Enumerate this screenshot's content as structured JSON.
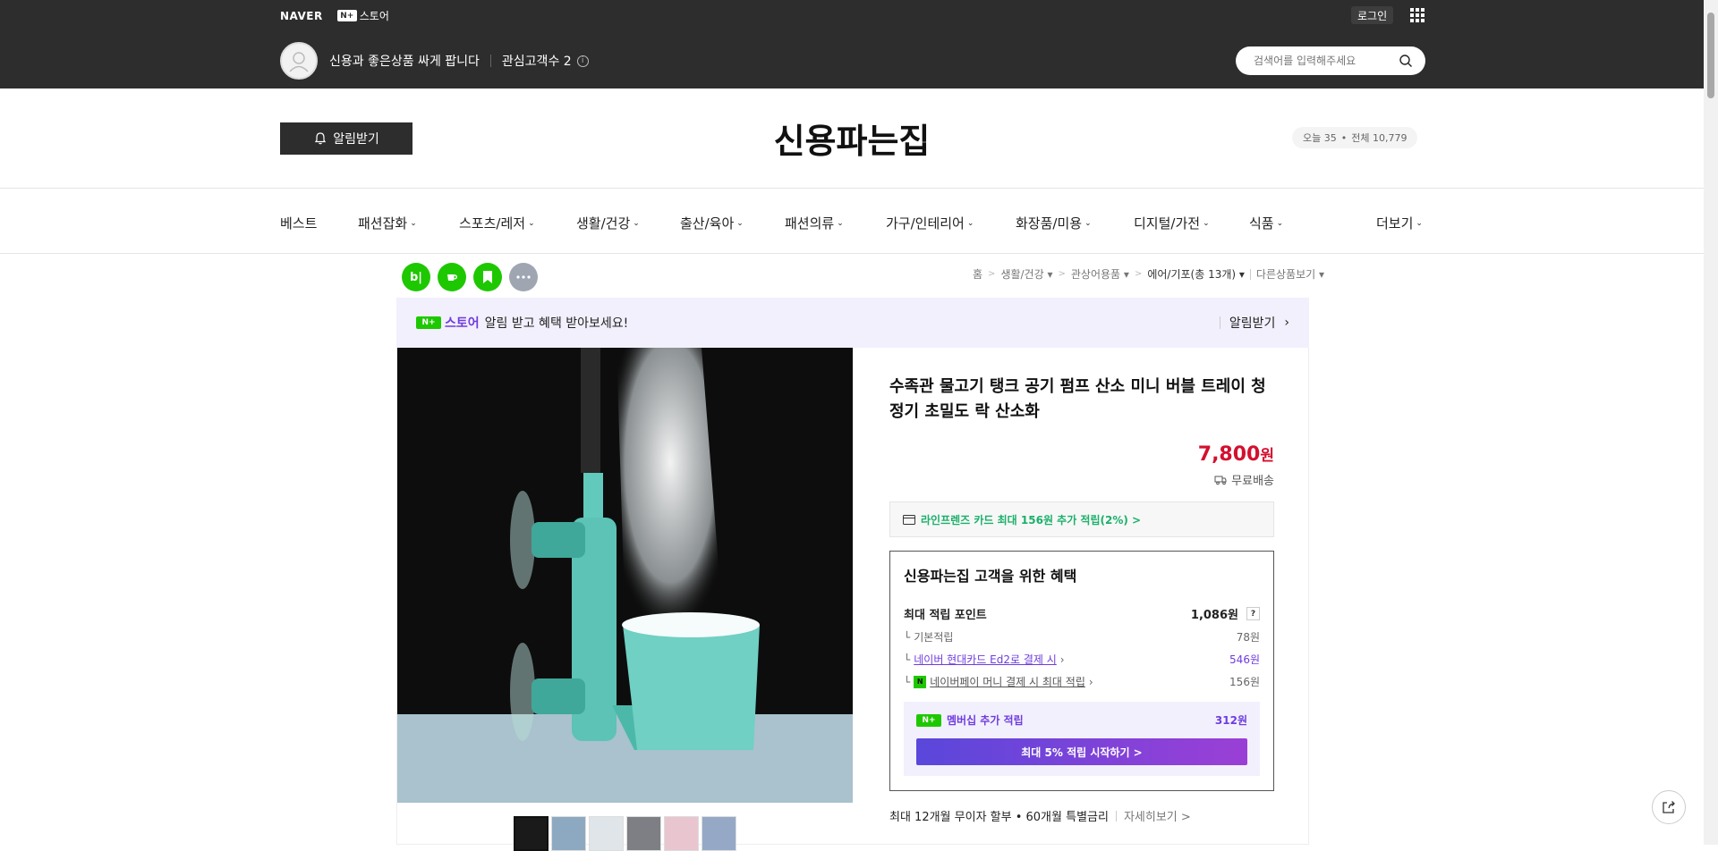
{
  "topbar": {
    "naver_logo": "NAVER",
    "nplus_badge": "N+",
    "nplus_label": "스토어",
    "login_label": "로그인",
    "seller_name": "신용과 좋은상품 싸게 팝니다",
    "fans_label": "관심고객수 2",
    "search_placeholder": "검색어를 입력해주세요"
  },
  "store_header": {
    "alarm_label": "알림받기",
    "store_title": "신용파는집",
    "visitors_today": "오늘 35",
    "visitors_dot": "•",
    "visitors_total": "전체 10,779"
  },
  "nav": {
    "items": [
      "베스트",
      "패션잡화",
      "스포츠/레저",
      "생활/건강",
      "출산/육아",
      "패션의류",
      "가구/인테리어",
      "화장품/미용",
      "디지털/가전",
      "식품",
      "더보기"
    ]
  },
  "sns": {
    "blog": "b|"
  },
  "breadcrumb": {
    "home": "홈",
    "cat1": "생활/건강",
    "cat2": "관상어용품",
    "cat3": "에어/기포(총 13개)",
    "other": "다른상품보기"
  },
  "promo": {
    "badge": "N+",
    "store": "스토어",
    "text": "알림 받고 혜택 받아보세요!",
    "action": "알림받기"
  },
  "product": {
    "title": "수족관 물고기 탱크 공기 펌프 산소 미니 버블 트레이 청정기 초밀도 락 산소화",
    "price": "7,800",
    "price_unit": "원",
    "shipping": "무료배송",
    "card_benefit": "라인프렌즈 카드 최대 156원 추가 적립(2%) >",
    "benefit_title": "신용파는집 고객을 위한 혜택",
    "max_points_label": "최대 적립 포인트",
    "max_points_value": "1,086원",
    "basic_label": "기본적립",
    "basic_value": "78원",
    "card_label": "네이버 현대카드 Ed2로 결제 시",
    "card_value": "546원",
    "pay_label": "네이버페이 머니 결제 시 최대 적립",
    "pay_value": "156원",
    "membership_badge": "N+",
    "membership_label": "멤버십 추가 적립",
    "membership_value": "312원",
    "membership_button": "최대 5% 적립 시작하기 >",
    "installment": "최대 12개월 무이자 할부 • 60개월 특별금리",
    "installment_more": "자세히보기 >"
  },
  "colors": {
    "accent_purple": "#6f3cde",
    "price_red": "#d3102f",
    "naver_green": "#1ec800",
    "topbar": "#2d2d2d"
  }
}
